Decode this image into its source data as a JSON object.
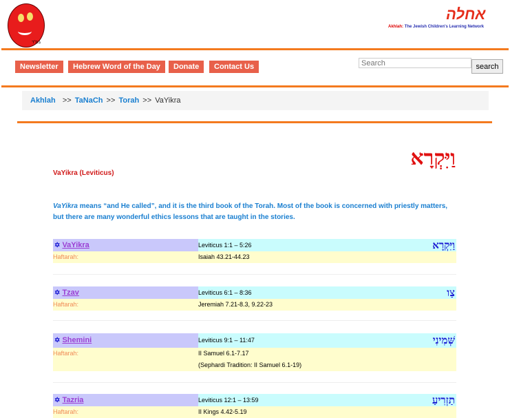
{
  "header": {
    "logo_left_caption": "בס\"ד",
    "logo_right_hebrew": "אחלה",
    "logo_right_tagline_brand": "Akhlah:",
    "logo_right_tagline": "The Jewish Children's Learning Network"
  },
  "nav": [
    "Newsletter",
    "Hebrew Word of the Day",
    "Donate",
    "Contact Us"
  ],
  "search": {
    "placeholder": "Search",
    "button": "search"
  },
  "breadcrumb": {
    "items": [
      "Akhlah",
      "TaNaCh",
      "Torah"
    ],
    "sep": ">>",
    "current": "VaYikra"
  },
  "title": {
    "hebrew": "וַיִּקְרָא",
    "english": "VaYikra (Leviticus)"
  },
  "intro": {
    "em": "VaYikra",
    "text": " means “and He called”, and it is the third book of the Torah. Most of the book is concerned with priestly matters, but there are many wonderful ethics lessons that are taught in the stories."
  },
  "haftarah_label": "Haftarah:",
  "parshiot": [
    {
      "name": "VaYikra",
      "ref": "Leviticus 1:1 – 5:26",
      "hebrew": "וַיִּקְרָא",
      "haftarah": [
        "Isaiah 43.21-44.23"
      ]
    },
    {
      "name": "Tzav",
      "ref": "Leviticus 6:1 – 8:36",
      "hebrew": "צַו",
      "haftarah": [
        "Jeremiah 7.21-8.3, 9.22-23"
      ]
    },
    {
      "name": "Shemini",
      "ref": "Leviticus 9:1 – 11:47",
      "hebrew": "שְּׁמִינִי",
      "haftarah": [
        "II Samuel 6.1-7.17",
        "(Sephardi Tradition: II Samuel 6.1-19)"
      ]
    },
    {
      "name": "Tazria",
      "ref": "Leviticus 12:1 – 13:59",
      "hebrew": "תַזְרִיעַ",
      "haftarah": [
        "II Kings 4.42-5.19"
      ]
    }
  ]
}
